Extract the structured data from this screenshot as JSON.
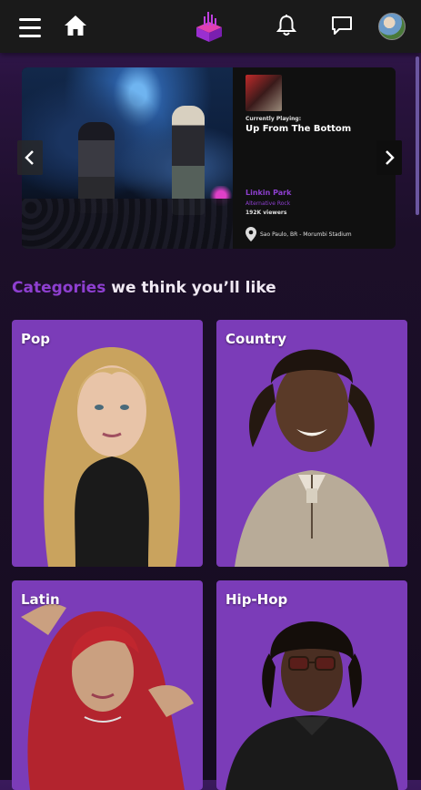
{
  "app": {
    "brand_color": "#8e3fd0",
    "icons": [
      "menu-icon",
      "home-icon",
      "logo-icon",
      "bell-icon",
      "chat-icon"
    ]
  },
  "now_playing": {
    "label": "Currently Playing:",
    "track": "Up From The Bottom",
    "artist": "Linkin Park",
    "genre": "Alternative Rock",
    "viewers": "192K viewers",
    "location": "Sao Paulo, BR - Morumbi Stadium"
  },
  "categories_heading": {
    "accent": "Categories",
    "rest": "we think you’ll like"
  },
  "categories": [
    {
      "label": "Pop"
    },
    {
      "label": "Country"
    },
    {
      "label": "Latin"
    },
    {
      "label": "Hip-Hop"
    }
  ]
}
